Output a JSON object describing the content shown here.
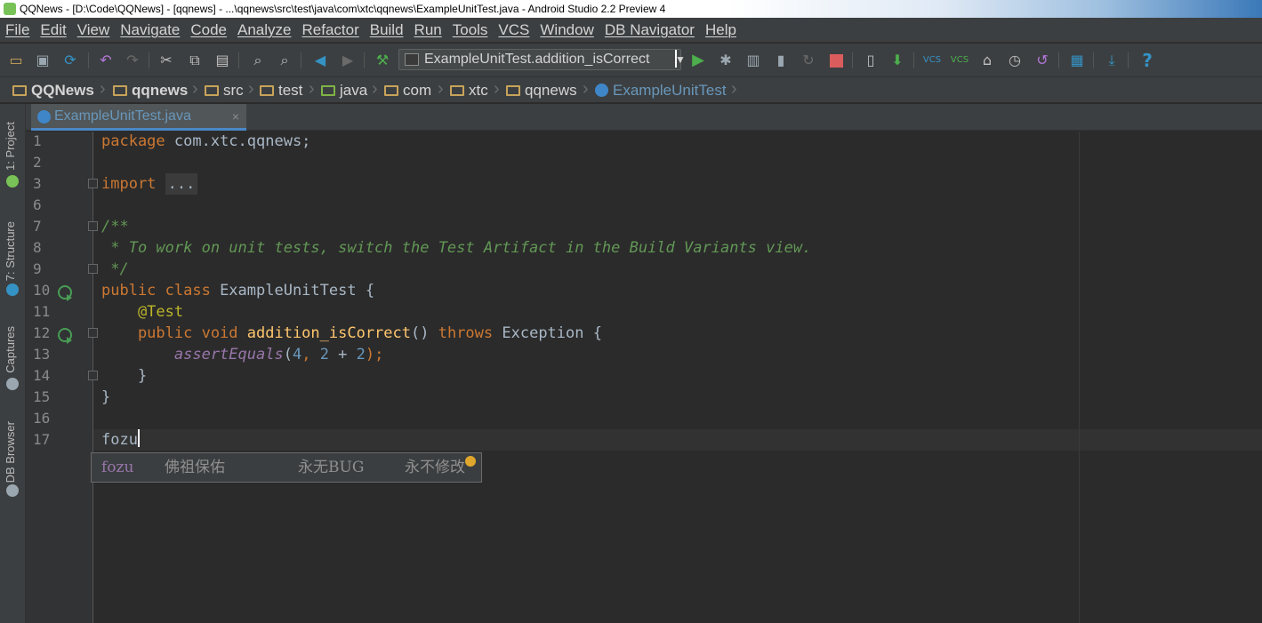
{
  "window": {
    "title": "QQNews - [D:\\Code\\QQNews] - [qqnews] - ...\\qqnews\\src\\test\\java\\com\\xtc\\qqnews\\ExampleUnitTest.java - Android Studio 2.2 Preview 4"
  },
  "menu": {
    "items": [
      "File",
      "Edit",
      "View",
      "Navigate",
      "Code",
      "Analyze",
      "Refactor",
      "Build",
      "Run",
      "Tools",
      "VCS",
      "Window",
      "DB Navigator",
      "Help"
    ]
  },
  "toolbar": {
    "run_config": "ExampleUnitTest.addition_isCorrect",
    "help": "?",
    "icons": [
      "open-folder-icon",
      "save-icon",
      "sync-icon",
      "undo-icon",
      "redo-icon",
      "cut-icon",
      "copy-icon",
      "paste-icon",
      "find-icon",
      "replace-icon",
      "back-icon",
      "forward-icon",
      "make-project-icon",
      "run-icon",
      "debug-icon",
      "coverage-icon",
      "profile-icon",
      "attach-debugger-icon",
      "stop-icon",
      "avd-manager-icon",
      "sdk-manager-icon",
      "vcs-update-icon",
      "vcs-commit-icon",
      "vcs-history-icon",
      "vcs-compare-icon",
      "revert-icon",
      "project-structure-icon",
      "download-icon",
      "help-icon"
    ],
    "colors": {
      "run": "#4cae4c",
      "stop": "#db5c5c",
      "accent": "#3592c4"
    }
  },
  "breadcrumbs": [
    "QQNews",
    "qqnews",
    "src",
    "test",
    "java",
    "com",
    "xtc",
    "qqnews",
    "ExampleUnitTest"
  ],
  "side_tabs": {
    "project": "1: Project",
    "structure": "7: Structure",
    "captures": "Captures",
    "db_browser": "DB Browser"
  },
  "editor": {
    "tab_label": "ExampleUnitTest.java",
    "tab_close": "×",
    "line_numbers": [
      "1",
      "2",
      "3",
      "6",
      "7",
      "8",
      "9",
      "10",
      "11",
      "12",
      "13",
      "14",
      "15",
      "16",
      "17"
    ],
    "code": {
      "l1_kw": "package",
      "l1_rest": " com.xtc.qqnews;",
      "l3_kw": "import",
      "l3_fold": "...",
      "l7": "/**",
      "l8": " * To work on unit tests, switch the Test Artifact in the Build Variants view.",
      "l9": " */",
      "l10_kw": "public class",
      "l10_rest": " ExampleUnitTest {",
      "l11": "    @Test",
      "l12_kw1": "    public void",
      "l12_fn": " addition_isCorrect",
      "l12_mid": "() ",
      "l12_kw2": "throws",
      "l12_rest": " Exception {",
      "l13_call": "        assertEquals",
      "l13_p1": "(",
      "l13_n1": "4",
      "l13_p2": ", ",
      "l13_n2": "2",
      "l13_p3": " + ",
      "l13_n3": "2",
      "l13_p4": ");",
      "l14": "    }",
      "l15": "}",
      "l17": "fozu"
    }
  },
  "completion": {
    "keyword": "fozu",
    "part1": "佛祖保佑",
    "part2": "永无BUG",
    "part3": "永不修改"
  }
}
